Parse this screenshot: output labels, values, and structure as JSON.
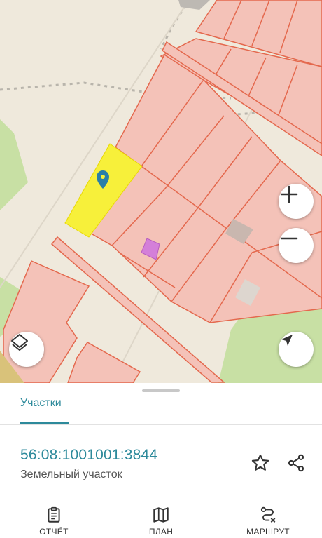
{
  "map": {
    "colors": {
      "background": "#efe9dc",
      "parcel_fill": "#f4c2b8",
      "parcel_border": "#e4684d",
      "selected_parcel": "#f7f03a",
      "green_area": "#c8e0a4",
      "building": "#d47fd9",
      "marker": "#2a7fa8"
    },
    "controls": {
      "zoom_in": "plus-icon",
      "zoom_out": "minus-icon",
      "layers": "layers-icon",
      "locate": "navigation-arrow-icon"
    }
  },
  "sheet": {
    "tab_label": "Участки",
    "parcel": {
      "cadastral_number": "56:08:1001001:3844",
      "type": "Земельный участок"
    },
    "actions": {
      "favorite": "star-icon",
      "share": "share-icon"
    }
  },
  "bottom_nav": {
    "items": [
      {
        "label": "ОТЧЁТ",
        "icon": "clipboard-icon"
      },
      {
        "label": "ПЛАН",
        "icon": "map-icon"
      },
      {
        "label": "МАРШРУТ",
        "icon": "route-icon"
      }
    ]
  }
}
